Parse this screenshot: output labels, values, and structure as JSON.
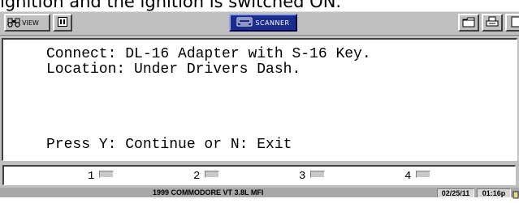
{
  "caption": {
    "text": "ignition and the ignition is switched ON."
  },
  "toolbar": {
    "view_label": "VIEW",
    "scanner_label": "SCANNER",
    "icons": [
      "binoculars-icon",
      "pause-icon",
      "scanner-icon",
      "folder-icon",
      "printer-icon"
    ]
  },
  "screen": {
    "line1": "Connect: DL-16 Adapter with S-16 Key.",
    "line2": "Location: Under Drivers Dash.",
    "line3": "Press Y: Continue or N: Exit"
  },
  "function_keys": [
    {
      "label": "1"
    },
    {
      "label": "2"
    },
    {
      "label": "3"
    },
    {
      "label": "4"
    }
  ],
  "status": {
    "vehicle": "1999 COMMODORE VT 3.8L MFI",
    "date": "02/25/11",
    "time": "01:16p"
  },
  "colors": {
    "toolbar_bg": "#c0c0c0",
    "scanner_button_bg": "#1b2d8a",
    "screen_bg": "#ffffff",
    "status_bg": "#a8a8a8"
  }
}
